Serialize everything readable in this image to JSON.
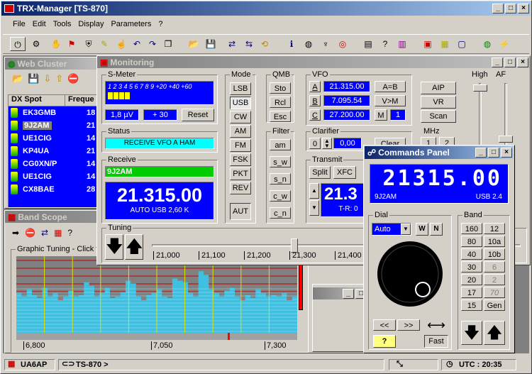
{
  "app": {
    "title": "TRX-Manager [TS-870]"
  },
  "menu": [
    "File",
    "Edit",
    "Tools",
    "Display",
    "Parameters",
    "?"
  ],
  "toolbar": [
    "power-icon",
    "connect-icon",
    "hand-icon",
    "antenna-icon",
    "shield-icon",
    "wand-icon",
    "hand-pointer-icon",
    "undo-icon",
    "redo-icon",
    "copy-icon",
    "open-folder-icon",
    "save-icon",
    "scan-icon",
    "scan2-icon",
    "sync-icon",
    "info-icon",
    "globe-icon",
    "map-pin-icon",
    "target-icon",
    "form-icon",
    "help-icon",
    "book-icon",
    "radio-icon",
    "keyboard-icon",
    "monitor-icon",
    "globe2-icon",
    "network-icon"
  ],
  "web_cluster": {
    "title": "Web Cluster",
    "headers": [
      "DX Spot",
      "Freque"
    ],
    "spots": [
      {
        "call": "EK3GMB",
        "freq": "18"
      },
      {
        "call": "9J2AM",
        "freq": "21"
      },
      {
        "call": "UE1CIG",
        "freq": "14"
      },
      {
        "call": "KP4UA",
        "freq": "21"
      },
      {
        "call": "CG0XN/P",
        "freq": "14"
      },
      {
        "call": "UE1CIG",
        "freq": "14"
      },
      {
        "call": "CX8BAE",
        "freq": "28"
      }
    ]
  },
  "band_scope": {
    "title": "Band Scope",
    "group_label": "Graphic Tuning - Click to",
    "ticks": [
      "6,800",
      "7,050",
      "7,300"
    ],
    "spectrum_levels": [
      0.55,
      0.5,
      0.6,
      0.52,
      0.48,
      0.62,
      0.5,
      0.55,
      0.45,
      0.5,
      0.58,
      0.5,
      0.52,
      0.7,
      0.65,
      0.5,
      0.55,
      0.62,
      0.48,
      0.5,
      0.56,
      0.72,
      0.68,
      0.5,
      0.45,
      0.52,
      0.55,
      0.6,
      0.5,
      0.48,
      0.75,
      0.72,
      0.7,
      0.55,
      0.5,
      0.85,
      0.8,
      0.6,
      0.55,
      0.5,
      0.58,
      0.62,
      0.5,
      0.45,
      0.52,
      0.48,
      0.6,
      0.55,
      0.5,
      0.52,
      0.5,
      0.55,
      0.45,
      0.5
    ]
  },
  "monitoring": {
    "title": "Monitoring",
    "smeter": {
      "label": "S-Meter",
      "scale": "1 2 3 4 5 6 7 8 9 +20 +40 +60",
      "level": "1,8 µV",
      "offset": "+ 30",
      "reset": "Reset"
    },
    "status": {
      "label": "Status",
      "text": "RECEIVE VFO A HAM"
    },
    "receive": {
      "label": "Receive",
      "call": "9J2AM",
      "freq": "21.315.00",
      "mode": "AUTO USB 2,60 K"
    },
    "mode": {
      "label": "Mode",
      "buttons": [
        "LSB",
        "USB",
        "CW",
        "AM",
        "FM",
        "FSK",
        "PKT",
        "REV"
      ],
      "aut": "AUT"
    },
    "qmb": {
      "label": "QMB",
      "buttons": [
        "Sto",
        "Rcl",
        "Esc"
      ]
    },
    "filter": {
      "label": "Filter",
      "buttons": [
        "am",
        "s_w",
        "s_n",
        "c_w",
        "c_n"
      ]
    },
    "vfo": {
      "label": "VFO",
      "rows": [
        {
          "key": "A",
          "freq": "21.315.00",
          "op": "A=B"
        },
        {
          "key": "B",
          "freq": "7.095.54",
          "op": "V>M"
        },
        {
          "key": "C",
          "freq": "27.200.00",
          "op": "M",
          "mem": "1"
        }
      ]
    },
    "right_buttons": [
      "AIP",
      "VR",
      "Scan"
    ],
    "clarifier": {
      "label": "Clarifier",
      "zero": "0",
      "value": "0,00",
      "clear": "Clear"
    },
    "transmit": {
      "label": "Transmit",
      "split": "Split",
      "xfc": "XFC",
      "freq": "21.3",
      "tr": "T-R: 0"
    },
    "tuning": {
      "label": "Tuning",
      "ticks": [
        "21,000",
        "21,100",
        "21,200",
        "21,300",
        "21,400"
      ]
    },
    "high": "High",
    "af": "AF",
    "mhz": "MHz",
    "mhz_buttons": [
      "1",
      "2"
    ]
  },
  "commands": {
    "title": "Commands Panel",
    "freq": "21315.00",
    "call": "9J2AM",
    "mode": "USB 2.4",
    "dial": {
      "label": "Dial",
      "mode": "Auto",
      "w": "W",
      "n": "N",
      "step_left": "<<",
      "step_right": ">>",
      "fast": "Fast",
      "help": "?"
    },
    "band": {
      "label": "Band",
      "buttons": [
        "160",
        "12",
        "80",
        "10a",
        "40",
        "10b",
        "30",
        "6",
        "20",
        "2",
        "17",
        "70",
        "15",
        "Gen"
      ],
      "disabled": [
        "6",
        "2",
        "70"
      ]
    }
  },
  "statusbar": {
    "user": "UA6AP",
    "rig": "TS-870 >",
    "utc": "UTC : 20:35"
  }
}
